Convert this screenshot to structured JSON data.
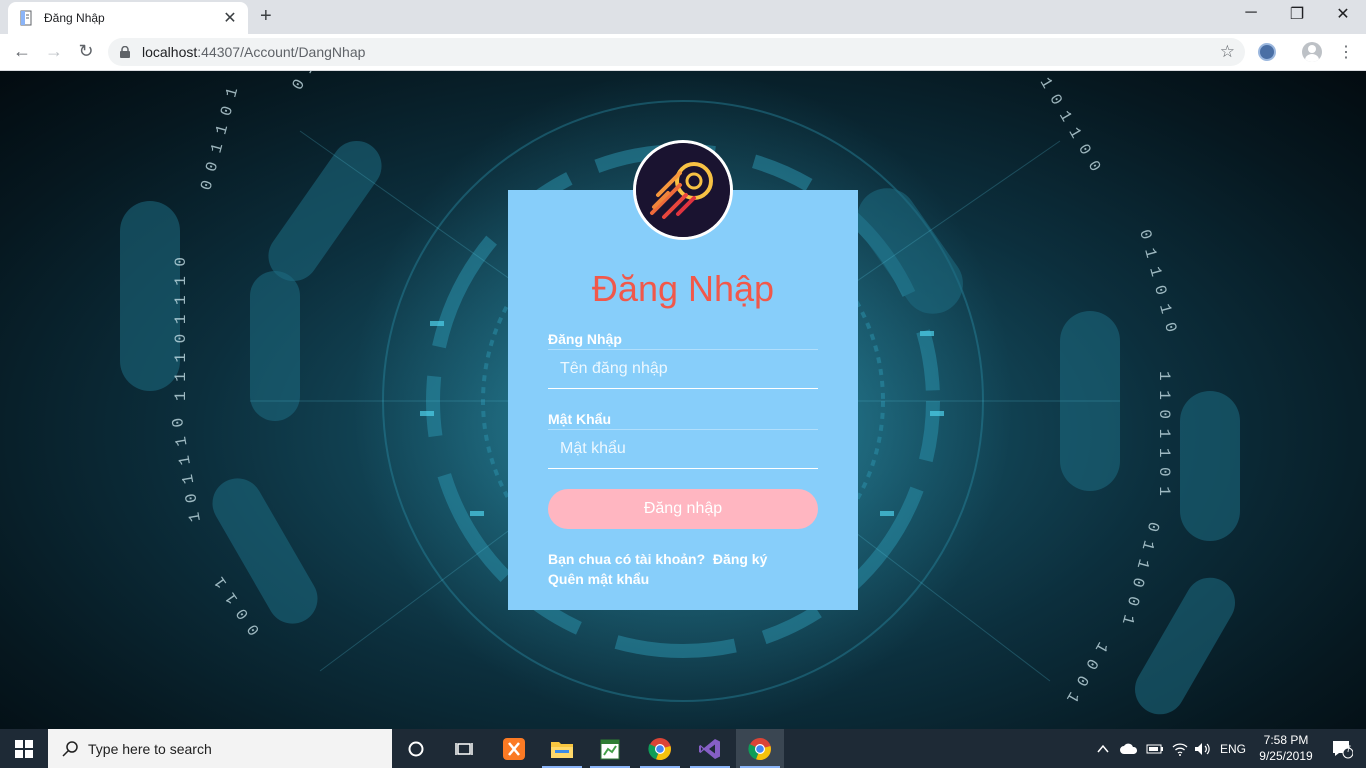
{
  "browser": {
    "tab_title": "Đăng Nhập",
    "url_host": "localhost",
    "url_path": ":44307/Account/DangNhap",
    "minimize": "─",
    "restore": "❐",
    "close": "✕",
    "new_tab": "+",
    "back": "←",
    "forward": "→",
    "reload": "↻",
    "star": "☆",
    "menu": "⋮",
    "tab_close": "✕"
  },
  "login": {
    "title": "Đăng Nhập",
    "username_label": "Đăng Nhập",
    "username_placeholder": "Tên đăng nhập",
    "password_label": "Mật Khẩu",
    "password_placeholder": "Mật khẩu",
    "submit_label": "Đăng nhập",
    "no_account_text": "Bạn chua có tài khoản?",
    "register_link": "Đăng ký",
    "forgot_link": "Quên mật khẩu"
  },
  "taskbar": {
    "search_placeholder": "Type here to search",
    "language": "ENG",
    "time": "7:58 PM",
    "date": "9/25/2019",
    "notification_count": "7"
  },
  "colors": {
    "card_bg": "#87cefa",
    "title_color": "#f1584a",
    "button_bg": "#ffb6c1"
  }
}
